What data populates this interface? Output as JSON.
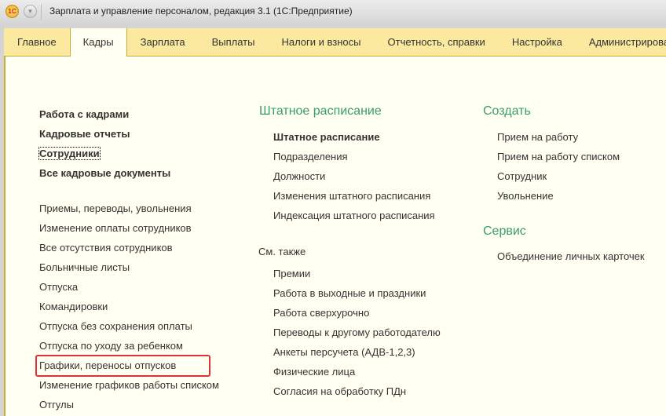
{
  "window": {
    "logo": "1С",
    "title": "Зарплата и управление персоналом, редакция 3.1  (1С:Предприятие)"
  },
  "tabs": [
    "Главное",
    "Кадры",
    "Зарплата",
    "Выплаты",
    "Налоги и взносы",
    "Отчетность, справки",
    "Настройка",
    "Администрирование"
  ],
  "left": {
    "bold": [
      "Работа с кадрами",
      "Кадровые отчеты",
      "Сотрудники",
      "Все кадровые документы"
    ],
    "items": [
      "Приемы, переводы, увольнения",
      "Изменение оплаты сотрудников",
      "Все отсутствия сотрудников",
      "Больничные листы",
      "Отпуска",
      "Командировки",
      "Отпуска без сохранения оплаты",
      "Отпуска по уходу за ребенком",
      "Графики, переносы отпусков",
      "Изменение графиков работы списком",
      "Отгулы"
    ]
  },
  "middle": {
    "heading": "Штатное расписание",
    "items": [
      "Штатное расписание",
      "Подразделения",
      "Должности",
      "Изменения штатного расписания",
      "Индексация штатного расписания"
    ],
    "see_also": "См. также",
    "see_items": [
      "Премии",
      "Работа в выходные и праздники",
      "Работа сверхурочно",
      "Переводы к другому работодателю",
      "Анкеты персучета (АДВ-1,2,3)",
      "Физические лица",
      "Согласия на обработку ПДн"
    ]
  },
  "right": {
    "create_heading": "Создать",
    "create_items": [
      "Прием на работу",
      "Прием на работу списком",
      "Сотрудник",
      "Увольнение"
    ],
    "service_heading": "Сервис",
    "service_items": [
      "Объединение личных карточек"
    ]
  }
}
